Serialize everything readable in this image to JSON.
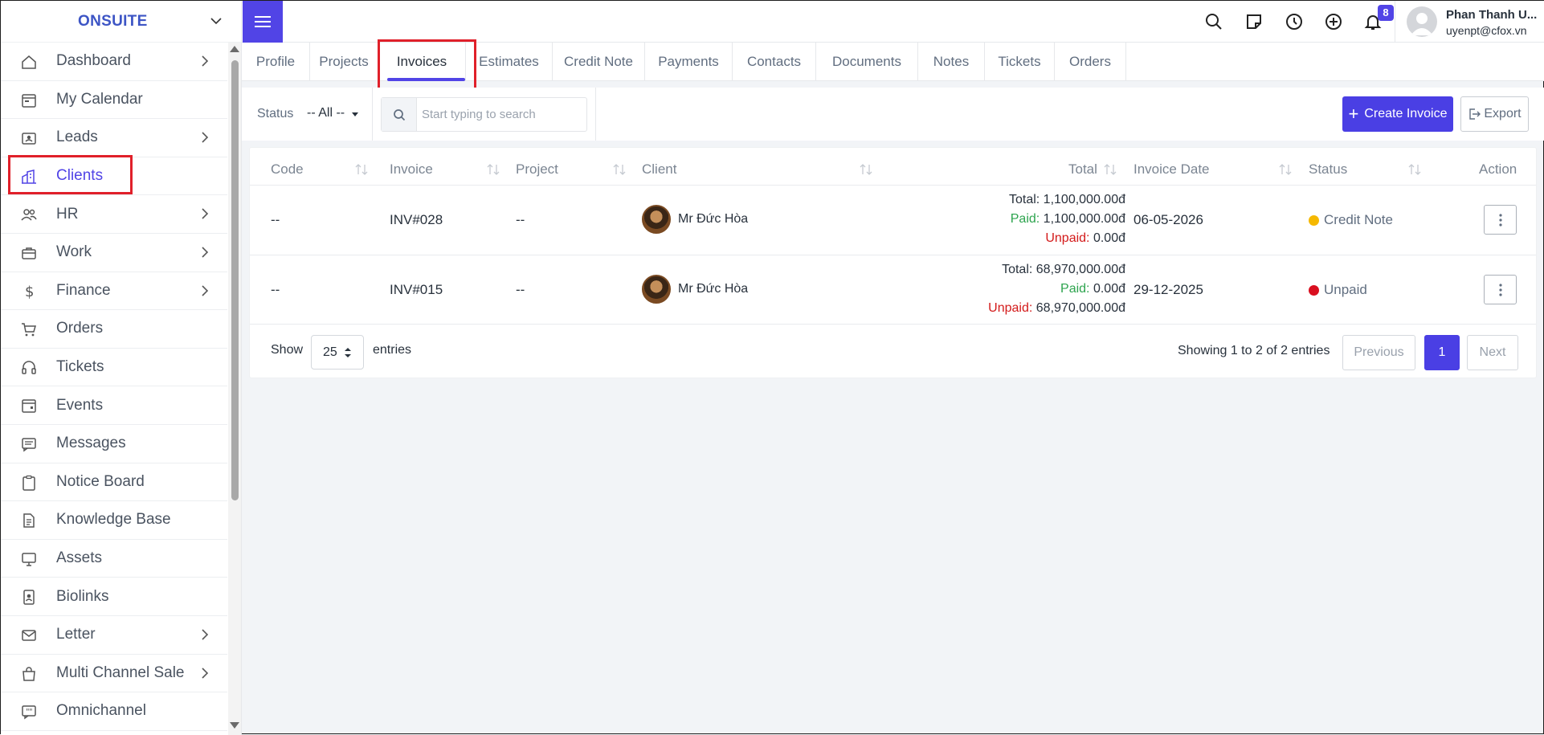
{
  "brand": {
    "name": "ONSUITE"
  },
  "sidebar": {
    "items": [
      {
        "label": "Dashboard",
        "icon": "home-icon",
        "has_children": true
      },
      {
        "label": "My Calendar",
        "icon": "calendar-icon",
        "has_children": false
      },
      {
        "label": "Leads",
        "icon": "id-card-icon",
        "has_children": true
      },
      {
        "label": "Clients",
        "icon": "building-icon",
        "has_children": false,
        "active": true
      },
      {
        "label": "HR",
        "icon": "people-icon",
        "has_children": true
      },
      {
        "label": "Work",
        "icon": "briefcase-icon",
        "has_children": true
      },
      {
        "label": "Finance",
        "icon": "dollar-icon",
        "has_children": true
      },
      {
        "label": "Orders",
        "icon": "cart-icon",
        "has_children": false
      },
      {
        "label": "Tickets",
        "icon": "headset-icon",
        "has_children": false
      },
      {
        "label": "Events",
        "icon": "calendar-event-icon",
        "has_children": false
      },
      {
        "label": "Messages",
        "icon": "message-icon",
        "has_children": false
      },
      {
        "label": "Notice Board",
        "icon": "clipboard-icon",
        "has_children": false
      },
      {
        "label": "Knowledge Base",
        "icon": "document-icon",
        "has_children": false
      },
      {
        "label": "Assets",
        "icon": "monitor-icon",
        "has_children": false
      },
      {
        "label": "Biolinks",
        "icon": "badge-icon",
        "has_children": false
      },
      {
        "label": "Letter",
        "icon": "envelope-icon",
        "has_children": true
      },
      {
        "label": "Multi Channel Sale",
        "icon": "bag-icon",
        "has_children": true
      },
      {
        "label": "Omnichannel",
        "icon": "chat-quote-icon",
        "has_children": false
      }
    ]
  },
  "topbar": {
    "notification_count": "8",
    "user_name": "Phan Thanh U...",
    "user_email": "uyenpt@cfox.vn"
  },
  "tabs": [
    {
      "label": "Profile"
    },
    {
      "label": "Projects"
    },
    {
      "label": "Invoices",
      "active": true
    },
    {
      "label": "Estimates"
    },
    {
      "label": "Credit Note"
    },
    {
      "label": "Payments"
    },
    {
      "label": "Contacts"
    },
    {
      "label": "Documents"
    },
    {
      "label": "Notes"
    },
    {
      "label": "Tickets"
    },
    {
      "label": "Orders"
    }
  ],
  "filters": {
    "status_label": "Status",
    "status_value": "-- All --",
    "search_placeholder": "Start typing to search",
    "create_label": "Create Invoice",
    "export_label": "Export"
  },
  "table": {
    "columns": [
      "Code",
      "Invoice",
      "Project",
      "Client",
      "Total",
      "Invoice Date",
      "Status",
      "Action"
    ],
    "rows": [
      {
        "code": "--",
        "invoice": "INV#028",
        "project": "--",
        "client": "Mr Đức Hòa",
        "total_label": "Total:",
        "total": "1,100,000.00đ",
        "paid_label": "Paid:",
        "paid": "1,100,000.00đ",
        "unpaid_label": "Unpaid:",
        "unpaid": "0.00đ",
        "date": "06-05-2026",
        "status": "Credit Note",
        "status_color": "#f5b800"
      },
      {
        "code": "--",
        "invoice": "INV#015",
        "project": "--",
        "client": "Mr Đức Hòa",
        "total_label": "Total:",
        "total": "68,970,000.00đ",
        "paid_label": "Paid:",
        "paid": "0.00đ",
        "unpaid_label": "Unpaid:",
        "unpaid": "68,970,000.00đ",
        "date": "29-12-2025",
        "status": "Unpaid",
        "status_color": "#d90f1f"
      }
    ]
  },
  "pagination": {
    "show_label": "Show",
    "page_size": "25",
    "entries_label": "entries",
    "summary": "Showing 1 to 2 of 2 entries",
    "previous_label": "Previous",
    "current_page": "1",
    "next_label": "Next"
  },
  "colors": {
    "accent": "#5144e6",
    "highlight": "#e0202a",
    "paid": "#2da44e",
    "unpaid": "#d31a1a"
  }
}
